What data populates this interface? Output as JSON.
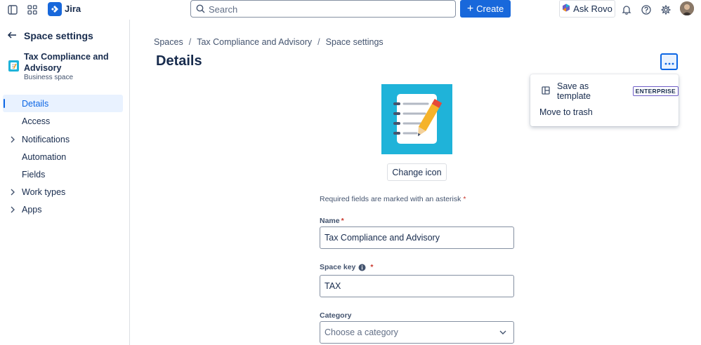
{
  "topbar": {
    "app_name": "Jira",
    "search_placeholder": "Search",
    "create_label": "Create",
    "rovo_label": "Ask Rovo"
  },
  "sidebar": {
    "title": "Space settings",
    "space_name": "Tax Compliance and Advisory",
    "space_type": "Business space",
    "items": [
      {
        "label": "Details"
      },
      {
        "label": "Access"
      },
      {
        "label": "Notifications"
      },
      {
        "label": "Automation"
      },
      {
        "label": "Fields"
      },
      {
        "label": "Work types"
      },
      {
        "label": "Apps"
      }
    ]
  },
  "breadcrumb": [
    "Spaces",
    "Tax Compliance and Advisory",
    "Space settings"
  ],
  "page_title": "Details",
  "menu": {
    "save_template": "Save as template",
    "badge": "ENTERPRISE",
    "move_trash": "Move to trash"
  },
  "form": {
    "change_icon_label": "Change icon",
    "required_note": "Required fields are marked with an asterisk",
    "asterisk": "*",
    "name_label": "Name",
    "name_value": "Tax Compliance and Advisory",
    "key_label": "Space key",
    "key_value": "TAX",
    "category_label": "Category",
    "category_placeholder": "Choose a category"
  },
  "colors": {
    "brand": "#1868db",
    "space_icon_bg": "#1fb3d9",
    "required": "#c9372c"
  }
}
